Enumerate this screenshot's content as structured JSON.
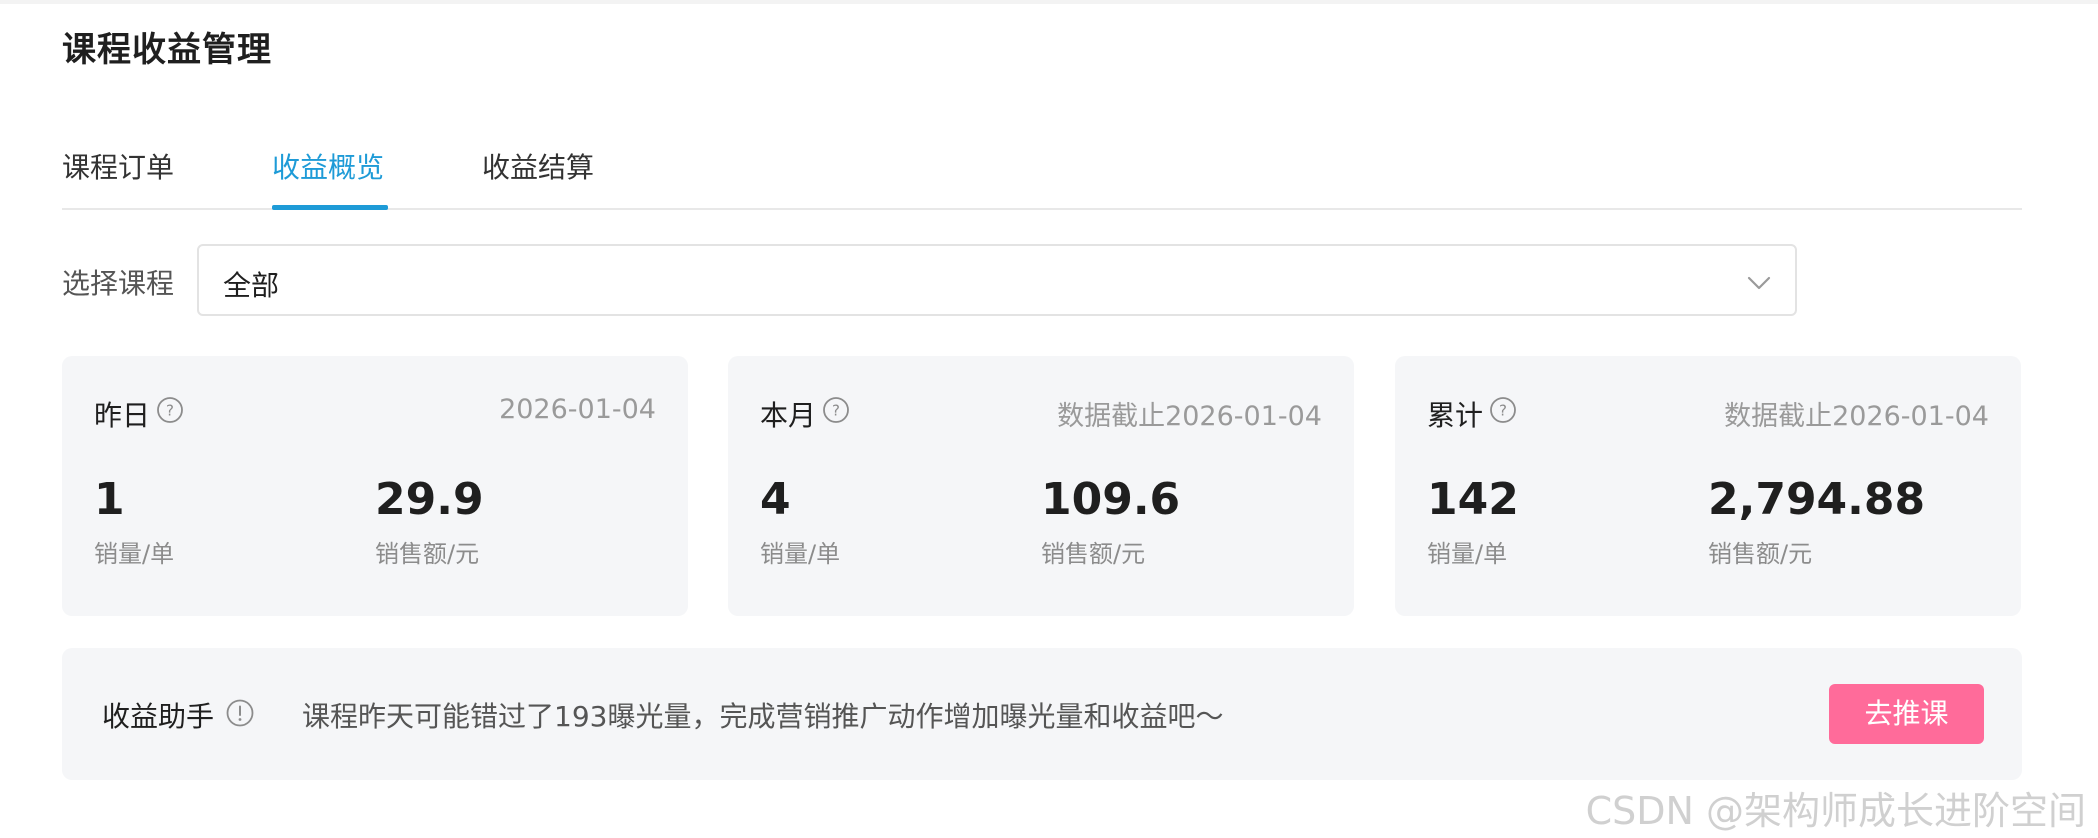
{
  "page": {
    "title": "课程收益管理"
  },
  "tabs": [
    {
      "label": "课程订单"
    },
    {
      "label": "收益概览",
      "active": true
    },
    {
      "label": "收益结算"
    }
  ],
  "filter": {
    "label": "选择课程",
    "value": "全部"
  },
  "cards": [
    {
      "title": "昨日",
      "date": "2026-01-04",
      "sales_count": "1",
      "sales_count_label": "销量/单",
      "sales_amount": "29.9",
      "sales_amount_label": "销售额/元"
    },
    {
      "title": "本月",
      "date": "数据截止2026-01-04",
      "sales_count": "4",
      "sales_count_label": "销量/单",
      "sales_amount": "109.6",
      "sales_amount_label": "销售额/元"
    },
    {
      "title": "累计",
      "date": "数据截止2026-01-04",
      "sales_count": "142",
      "sales_count_label": "销量/单",
      "sales_amount": "2,794.88",
      "sales_amount_label": "销售额/元"
    }
  ],
  "assistant": {
    "title": "收益助手",
    "message": "课程昨天可能错过了193曝光量，完成营销推广动作增加曝光量和收益吧～",
    "button_label": "去推课"
  },
  "watermark": "CSDN @架构师成长进阶空间",
  "colors": {
    "accent": "#1e9bd7",
    "button": "#ff6b9a",
    "card_bg": "#f5f6f8"
  },
  "icons": {
    "help": "question-circle-icon",
    "info": "exclamation-circle-icon",
    "dropdown": "chevron-down-icon"
  }
}
